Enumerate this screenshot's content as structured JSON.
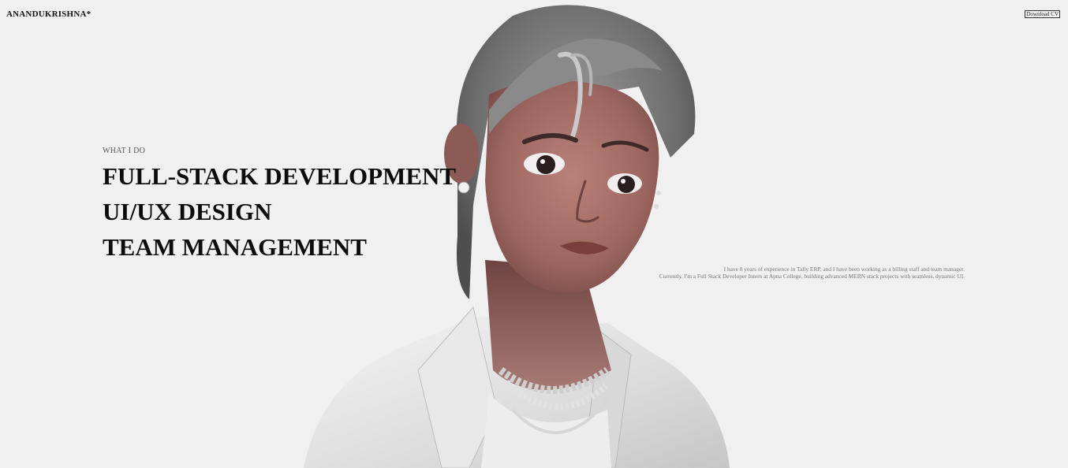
{
  "header": {
    "logo": "ANANDUKRISHNA*",
    "download_cv": "Download CV"
  },
  "services": {
    "kicker": "WHAT I DO",
    "items": [
      "FULL-STACK DEVELOPMENT",
      "UI/UX DESIGN",
      "TEAM MANAGEMENT"
    ]
  },
  "about": {
    "lines": [
      "I have 8 years of experience in Tally ERP, and I have been working as a billing staff and team manager.",
      "Currently, I'm a Full Stack Developer Intern at Apna College, building advanced MERN stack projects with seamless, dynamic UI."
    ]
  },
  "colors": {
    "background": "#f1f0f0",
    "text": "#111111",
    "muted": "#777777"
  },
  "hero_image": "3d-character-portrait"
}
